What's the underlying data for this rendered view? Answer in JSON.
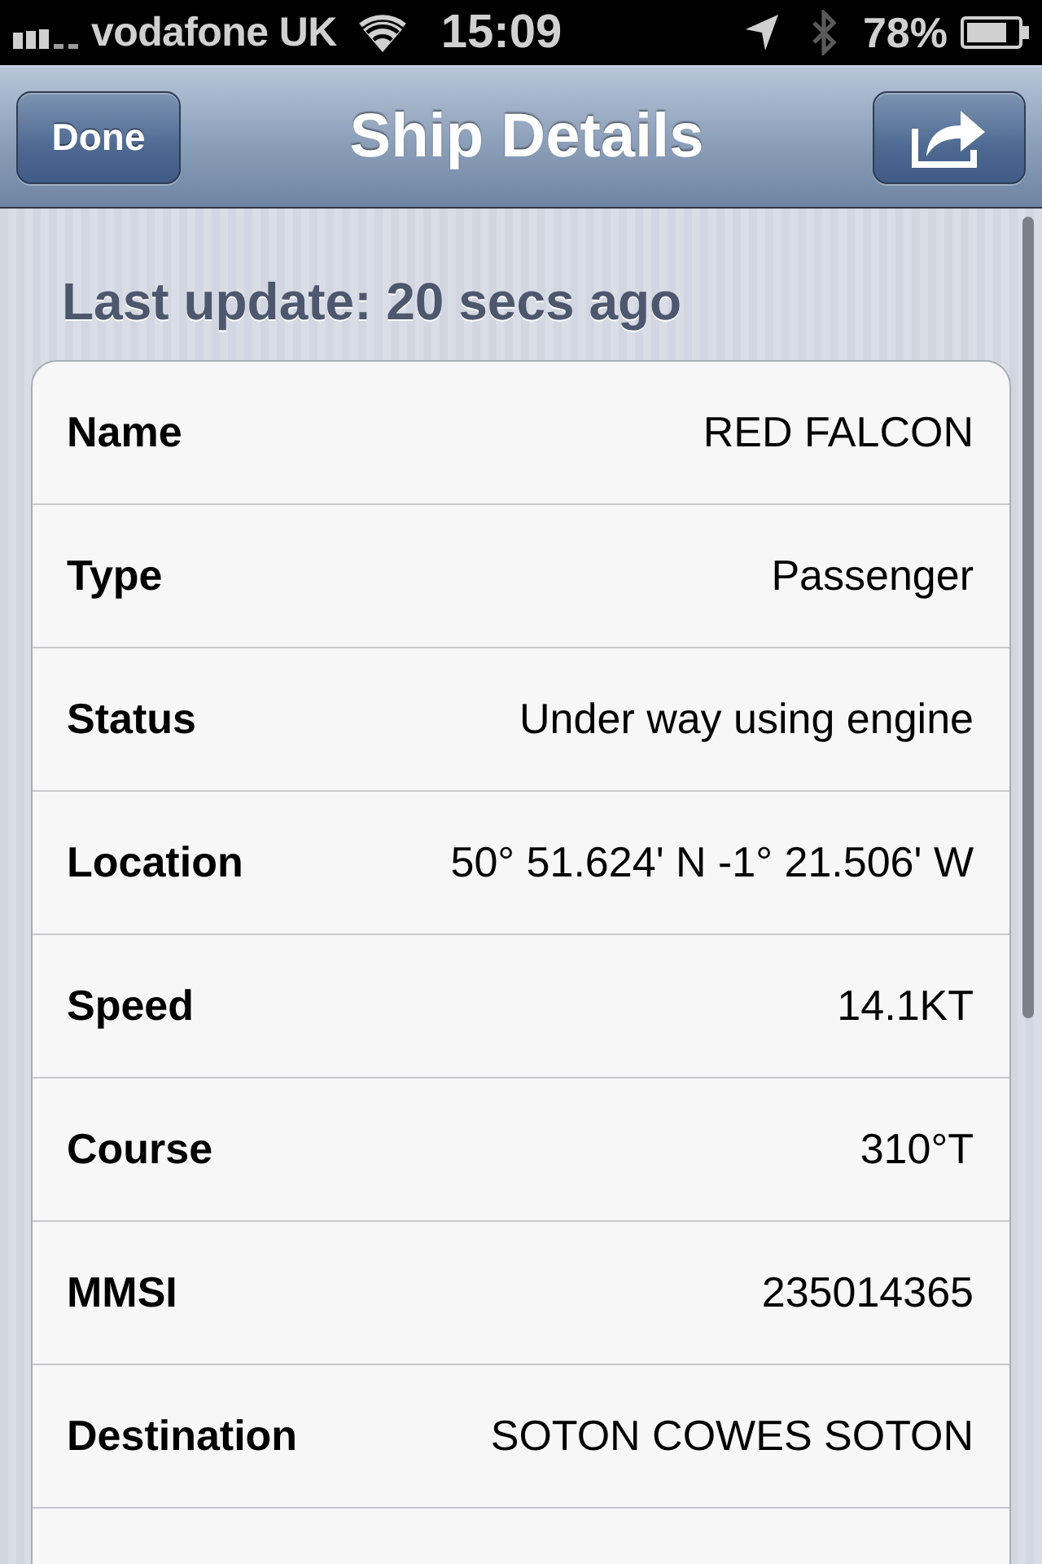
{
  "status_bar": {
    "carrier": "vodafone UK",
    "time": "15:09",
    "battery": "78%"
  },
  "nav_bar": {
    "title": "Ship Details",
    "left_button": "Done"
  },
  "last_update": "Last update: 20 secs ago",
  "details": [
    {
      "label": "Name",
      "value": "RED FALCON"
    },
    {
      "label": "Type",
      "value": "Passenger"
    },
    {
      "label": "Status",
      "value": "Under way using engine"
    },
    {
      "label": "Location",
      "value": "50° 51.624' N -1° 21.506' W"
    },
    {
      "label": "Speed",
      "value": "14.1KT"
    },
    {
      "label": "Course",
      "value": "310°T"
    },
    {
      "label": "MMSI",
      "value": "235014365"
    },
    {
      "label": "Destination",
      "value": "SOTON COWES SOTON"
    }
  ]
}
